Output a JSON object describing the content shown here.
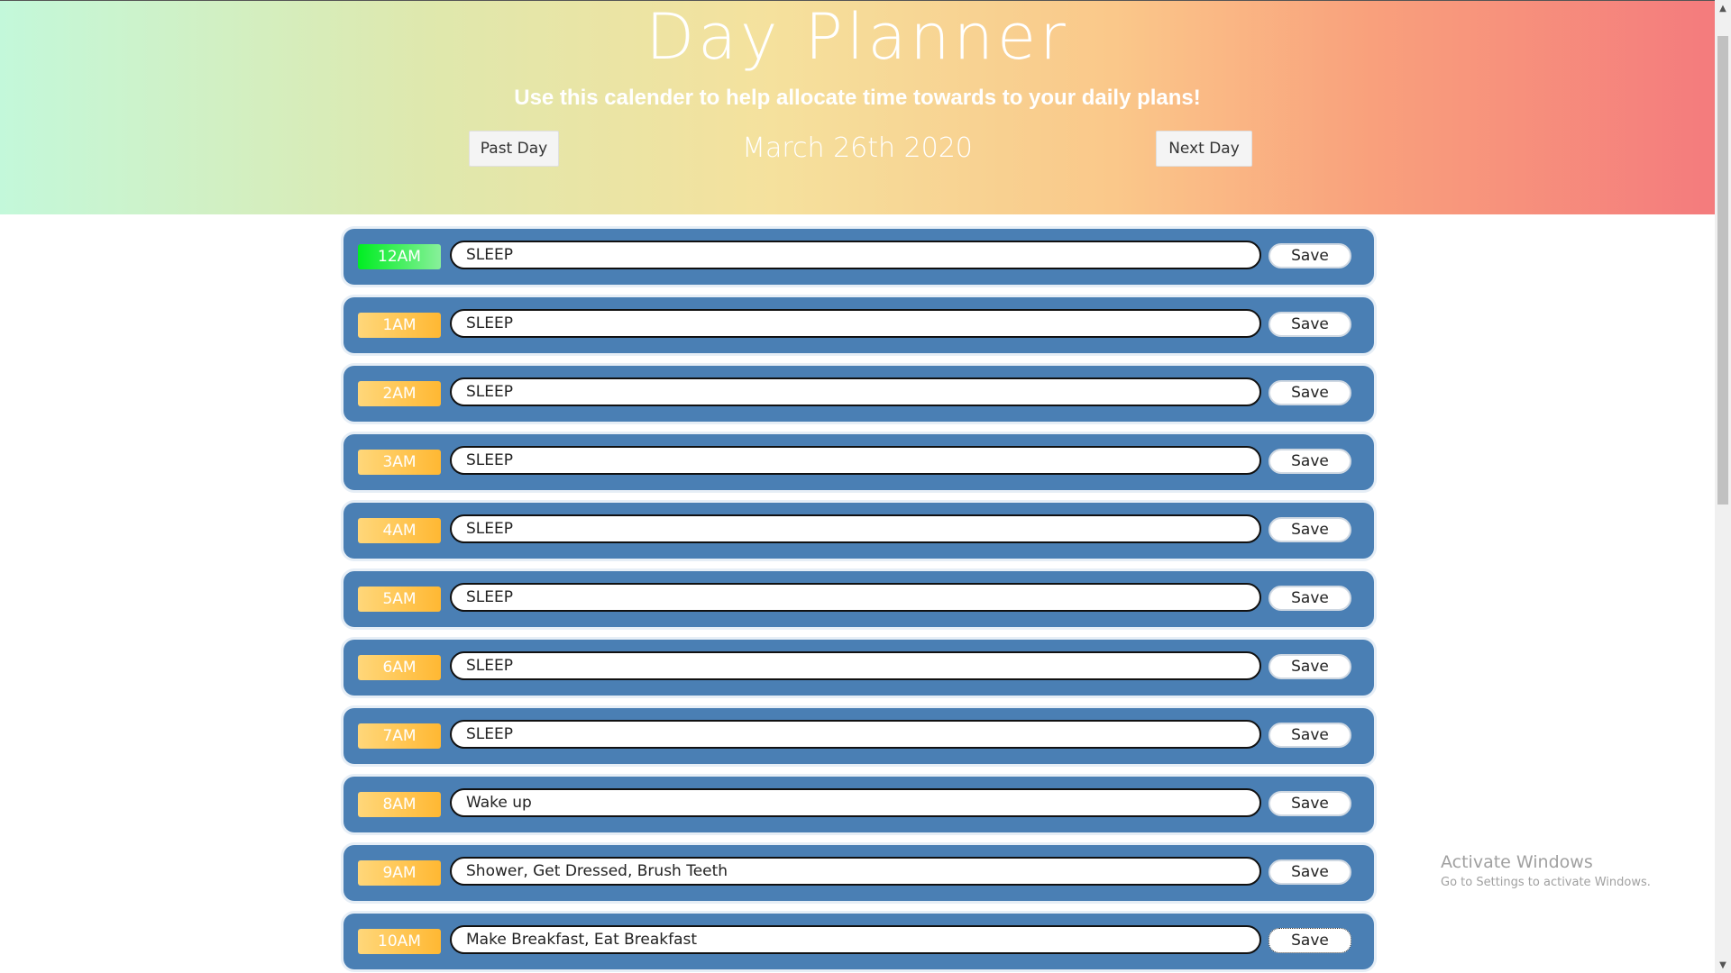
{
  "header": {
    "title": "Day Planner",
    "subtitle": "Use this calender to help allocate time towards to your daily plans!",
    "date": "March 26th 2020",
    "past_button": "Past Day",
    "next_button": "Next Day"
  },
  "colors": {
    "row_background": "#4a7fb4",
    "current_hour": "#00ee22",
    "future_hour": "#ffb833"
  },
  "rows": [
    {
      "hour": "12AM",
      "task": "SLEEP",
      "save": "Save",
      "state": "current"
    },
    {
      "hour": "1AM",
      "task": "SLEEP",
      "save": "Save",
      "state": "future"
    },
    {
      "hour": "2AM",
      "task": "SLEEP",
      "save": "Save",
      "state": "future"
    },
    {
      "hour": "3AM",
      "task": "SLEEP",
      "save": "Save",
      "state": "future"
    },
    {
      "hour": "4AM",
      "task": "SLEEP",
      "save": "Save",
      "state": "future"
    },
    {
      "hour": "5AM",
      "task": "SLEEP",
      "save": "Save",
      "state": "future"
    },
    {
      "hour": "6AM",
      "task": "SLEEP",
      "save": "Save",
      "state": "future"
    },
    {
      "hour": "7AM",
      "task": "SLEEP",
      "save": "Save",
      "state": "future"
    },
    {
      "hour": "8AM",
      "task": "Wake up",
      "save": "Save",
      "state": "future"
    },
    {
      "hour": "9AM",
      "task": "Shower, Get Dressed, Brush Teeth",
      "save": "Save",
      "state": "future"
    },
    {
      "hour": "10AM",
      "task": "Make Breakfast, Eat Breakfast",
      "save": "Save",
      "state": "future"
    }
  ],
  "watermark": {
    "title": "Activate Windows",
    "subtitle": "Go to Settings to activate Windows."
  }
}
